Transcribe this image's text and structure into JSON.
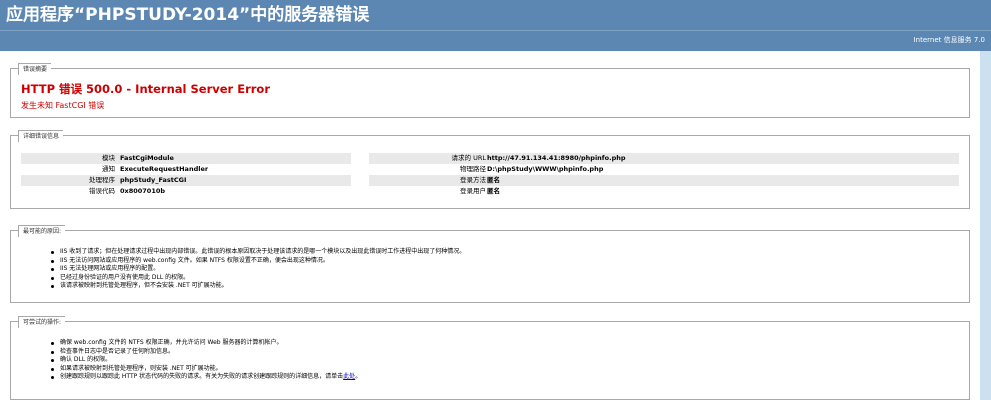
{
  "header": {
    "title": "应用程序“PHPSTUDY-2014”中的服务器错误",
    "server_label": "Internet 信息服务 7.0"
  },
  "summary": {
    "legend": "错误摘要",
    "heading": "HTTP 错误 500.0 - Internal Server Error",
    "subheading": "发生未知 FastCGI 错误"
  },
  "detail": {
    "legend": "详细错误信息",
    "left": [
      {
        "label": "模块",
        "value": "FastCgiModule"
      },
      {
        "label": "通知",
        "value": "ExecuteRequestHandler"
      },
      {
        "label": "处理程序",
        "value": "phpStudy_FastCGI"
      },
      {
        "label": "错误代码",
        "value": "0x8007010b"
      }
    ],
    "right": [
      {
        "label": "请求的 URL",
        "value": "http://47.91.134.41:8980/phpinfo.php"
      },
      {
        "label": "物理路径",
        "value": "D:\\phpStudy\\WWW\\phpinfo.php"
      },
      {
        "label": "登录方法",
        "value": "匿名"
      },
      {
        "label": "登录用户",
        "value": "匿名"
      }
    ]
  },
  "causes": {
    "legend": "最可能的原因:",
    "items": [
      "IIS 收到了请求；但在处理请求过程中出现内部错误。此错误的根本原因取决于处理该请求的是哪一个模块以及出现此错误时工作进程中出现了何种情况。",
      "IIS 无法访问网站或应用程序的 web.config 文件。如果 NTFS 权限设置不正确，便会出现这种情况。",
      "IIS 无法处理网站或应用程序的配置。",
      "已经过身份验证的用户没有使用此 DLL 的权限。",
      "该请求被映射到托管处理程序，但不会安装 .NET 可扩展功能。"
    ]
  },
  "actions": {
    "legend": "可尝试的操作:",
    "items": [
      "确保 web.config 文件的 NTFS 权限正确，并允许访问 Web 服务器的计算机帐户。",
      "检查事件日志中是否记录了任何附加信息。",
      "确认 DLL 的权限。",
      "如果请求被映射到托管处理程序，则安装 .NET 可扩展功能。",
      "创建跟踪规则以跟踪此 HTTP 状态代码的失败的请求。有关为失败的请求创建跟踪规则的详细信息，请单击"
    ],
    "link_text": "此处",
    "link_suffix": "。"
  }
}
